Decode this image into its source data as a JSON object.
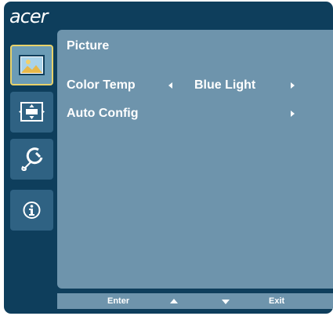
{
  "brand": {
    "logo_text": "acer"
  },
  "sidebar": {
    "tabs": [
      {
        "icon": "picture-icon",
        "selected": true
      },
      {
        "icon": "image-position-icon",
        "selected": false
      },
      {
        "icon": "settings-icon",
        "selected": false
      },
      {
        "icon": "info-icon",
        "selected": false
      }
    ]
  },
  "menu": {
    "title": "Picture",
    "items": [
      {
        "label": "Color Temp",
        "value": "Blue Light",
        "has_left_arrow": true,
        "has_right_arrow": true
      },
      {
        "label": "Auto Config",
        "value": "",
        "has_left_arrow": false,
        "has_right_arrow": true
      }
    ]
  },
  "footer": {
    "enter_label": "Enter",
    "up_icon": "up-arrow-icon",
    "down_icon": "down-arrow-icon",
    "exit_label": "Exit"
  },
  "colors": {
    "background": "#0e3e5c",
    "panel": "#6e94ac",
    "selected_border": "#e8d26a",
    "text": "#ffffff"
  }
}
